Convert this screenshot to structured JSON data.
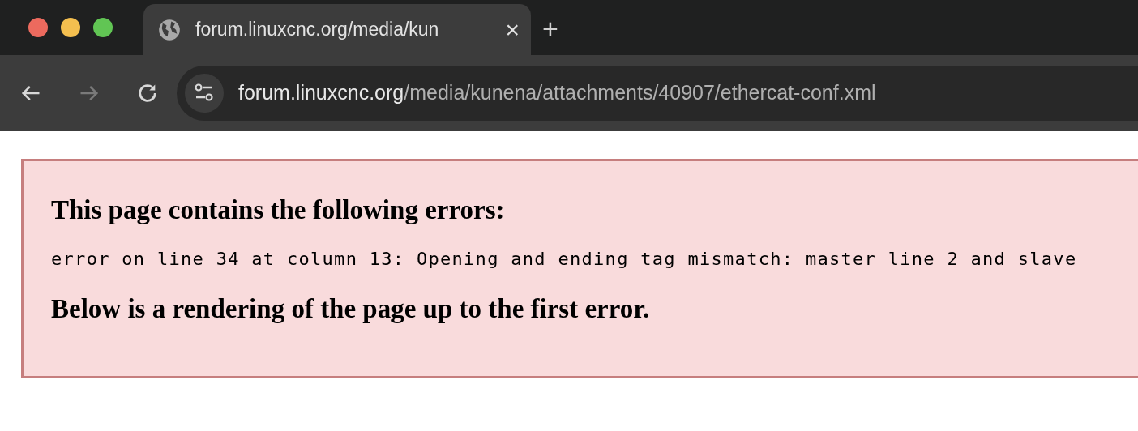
{
  "tab": {
    "title": "forum.linuxcnc.org/media/kun",
    "close": "×"
  },
  "new_tab": "+",
  "address": {
    "host": "forum.linuxcnc.org",
    "path": "/media/kunena/attachments/40907/ethercat-conf.xml"
  },
  "error_box": {
    "heading": "This page contains the following errors:",
    "message": "error on line 34 at column 13: Opening and ending tag mismatch: master line 2 and slave",
    "footer": "Below is a rendering of the page up to the first error."
  }
}
